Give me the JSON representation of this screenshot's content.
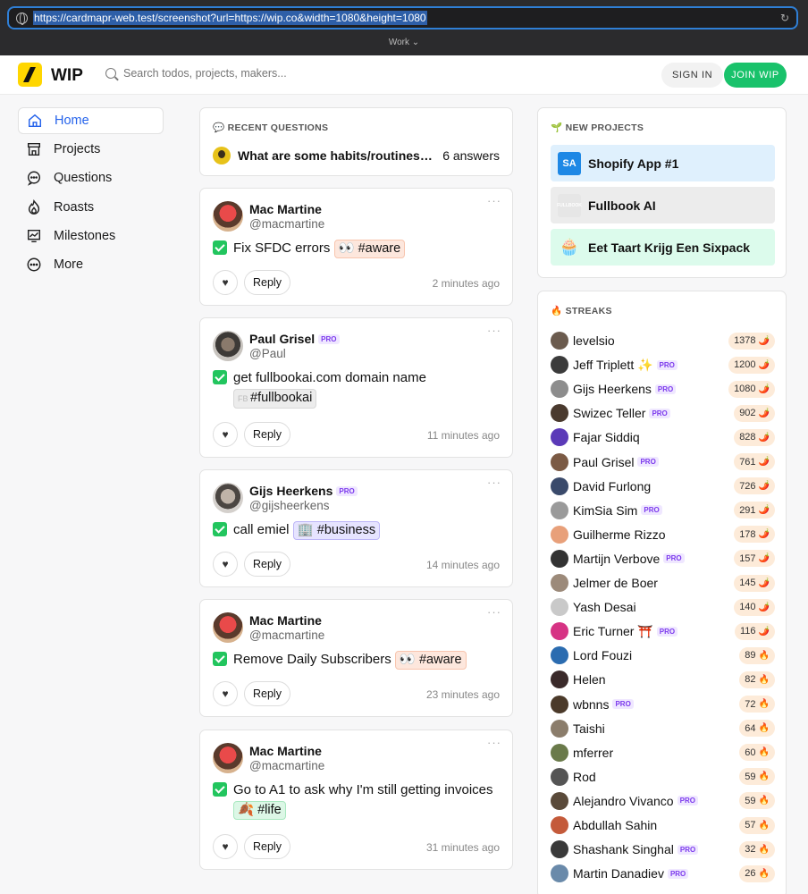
{
  "browser": {
    "url": "https://cardmapr-web.test/screenshot?url=https://wip.co&width=1080&height=1080",
    "workspace": "Work ⌄"
  },
  "header": {
    "brand": "WIP",
    "search_placeholder": "Search todos, projects, makers...",
    "signin_label": "SIGN IN",
    "join_label": "JOIN WIP"
  },
  "nav": {
    "items": [
      {
        "label": "Home",
        "icon": "home-icon",
        "active": true
      },
      {
        "label": "Projects",
        "icon": "store-icon"
      },
      {
        "label": "Questions",
        "icon": "chat-bubble-icon"
      },
      {
        "label": "Roasts",
        "icon": "flame-icon"
      },
      {
        "label": "Milestones",
        "icon": "chart-icon"
      },
      {
        "label": "More",
        "icon": "more-circle-icon"
      }
    ]
  },
  "recent_questions": {
    "title": "💬 RECENT QUESTIONS",
    "question": "What are some habits/routines you",
    "answers": "6 answers"
  },
  "posts": [
    {
      "name": "Mac Martine",
      "pro": "",
      "handle": "@macmartine",
      "text": "Fix SFDC errors",
      "tag": "👀 #aware",
      "time": "2 minutes ago",
      "reply": "Reply"
    },
    {
      "name": "Paul Grisel",
      "pro": "PRO",
      "handle": "@Paul",
      "text": "get fullbookai.com domain name",
      "tag": "#fullbookai",
      "time": "11 minutes ago",
      "reply": "Reply"
    },
    {
      "name": "Gijs Heerkens",
      "pro": "PRO",
      "handle": "@gijsheerkens",
      "text": "call emiel",
      "tag": "🏢 #business",
      "time": "14 minutes ago",
      "reply": "Reply"
    },
    {
      "name": "Mac Martine",
      "pro": "",
      "handle": "@macmartine",
      "text": "Remove Daily Subscribers",
      "tag": "👀 #aware",
      "time": "23 minutes ago",
      "reply": "Reply"
    },
    {
      "name": "Mac Martine",
      "pro": "",
      "handle": "@macmartine",
      "text": "Go to A1 to ask why I'm still getting invoices",
      "tag": "🍂 #life",
      "time": "31 minutes ago",
      "reply": "Reply"
    }
  ],
  "new_projects": {
    "title": "🌱 NEW PROJECTS",
    "items": [
      {
        "name": "Shopify App #1",
        "icon_text": "SA"
      },
      {
        "name": "Fullbook AI",
        "icon_text": "FULLBOOK"
      },
      {
        "name": "Eet Taart Krijg Een Sixpack",
        "icon_text": "🧁"
      }
    ]
  },
  "streaks": {
    "title": "🔥 STREAKS",
    "items": [
      {
        "name": "levelsio",
        "pro": "",
        "count": "1378",
        "icon": "🌶️"
      },
      {
        "name": "Jeff Triplett ✨",
        "pro": "PRO",
        "count": "1200",
        "icon": "🌶️"
      },
      {
        "name": "Gijs Heerkens",
        "pro": "PRO",
        "count": "1080",
        "icon": "🌶️"
      },
      {
        "name": "Swizec Teller",
        "pro": "PRO",
        "count": "902",
        "icon": "🌶️"
      },
      {
        "name": "Fajar Siddiq",
        "pro": "",
        "count": "828",
        "icon": "🌶️"
      },
      {
        "name": "Paul Grisel",
        "pro": "PRO",
        "count": "761",
        "icon": "🌶️"
      },
      {
        "name": "David Furlong",
        "pro": "",
        "count": "726",
        "icon": "🌶️"
      },
      {
        "name": "KimSia Sim",
        "pro": "PRO",
        "count": "291",
        "icon": "🌶️"
      },
      {
        "name": "Guilherme Rizzo",
        "pro": "",
        "count": "178",
        "icon": "🌶️"
      },
      {
        "name": "Martijn Verbove",
        "pro": "PRO",
        "count": "157",
        "icon": "🌶️"
      },
      {
        "name": "Jelmer de Boer",
        "pro": "",
        "count": "145",
        "icon": "🌶️"
      },
      {
        "name": "Yash Desai",
        "pro": "",
        "count": "140",
        "icon": "🌶️"
      },
      {
        "name": "Eric Turner ⛩️",
        "pro": "PRO",
        "count": "116",
        "icon": "🌶️"
      },
      {
        "name": "Lord Fouzi",
        "pro": "",
        "count": "89",
        "icon": "🔥"
      },
      {
        "name": "Helen",
        "pro": "",
        "count": "82",
        "icon": "🔥"
      },
      {
        "name": "wbnns",
        "pro": "PRO",
        "count": "72",
        "icon": "🔥"
      },
      {
        "name": "Taishi",
        "pro": "",
        "count": "64",
        "icon": "🔥"
      },
      {
        "name": "mferrer",
        "pro": "",
        "count": "60",
        "icon": "🔥"
      },
      {
        "name": "Rod",
        "pro": "",
        "count": "59",
        "icon": "🔥"
      },
      {
        "name": "Alejandro Vivanco",
        "pro": "PRO",
        "count": "59",
        "icon": "🔥"
      },
      {
        "name": "Abdullah Sahin",
        "pro": "",
        "count": "57",
        "icon": "🔥"
      },
      {
        "name": "Shashank Singhal",
        "pro": "PRO",
        "count": "32",
        "icon": "🔥"
      },
      {
        "name": "Martin Danadiev",
        "pro": "PRO",
        "count": "26",
        "icon": "🔥"
      }
    ]
  },
  "colors": {
    "accent": "#2563eb",
    "join": "#19c26b",
    "logo": "#ffd600",
    "check": "#22c55e"
  }
}
